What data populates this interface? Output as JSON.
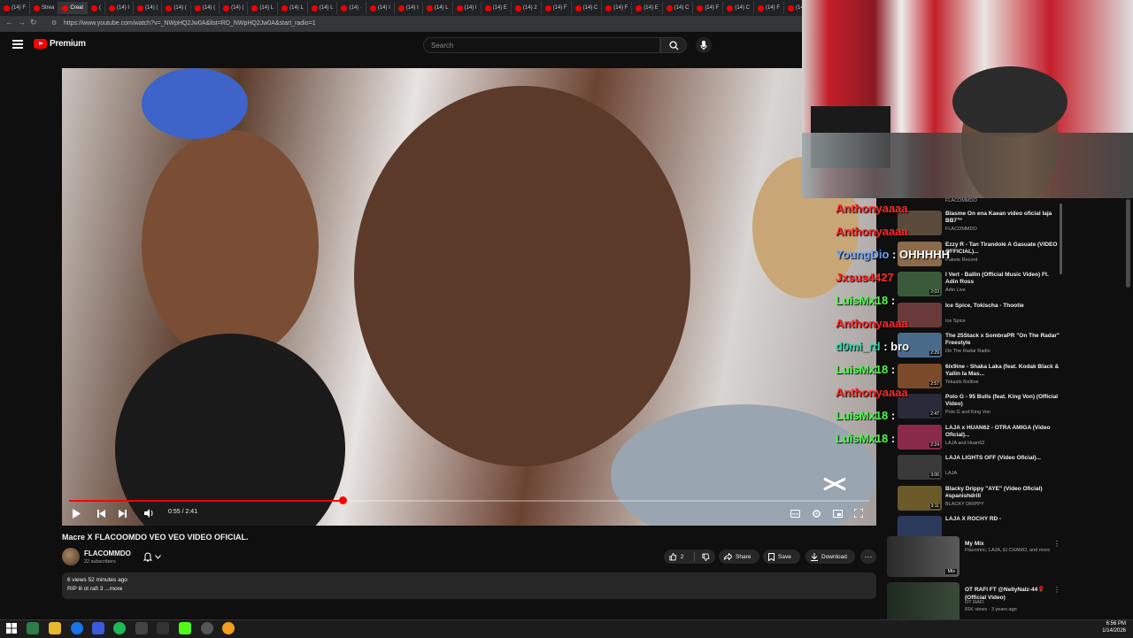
{
  "browser": {
    "tabs": [
      "(14) F",
      "Strea",
      "Creat",
      "(",
      "(14) I",
      "(14) (",
      "(14) (",
      "(14) (",
      "(14) (",
      "(14) L",
      "(14) L",
      "(14) L",
      "(14) ·",
      "(14) I",
      "(14) I",
      "(14) L",
      "(14) I",
      "(14) E",
      "(14) 2",
      "(14) F",
      "(14) C",
      "(14) F",
      "(14) E",
      "(14) C",
      "(14) F",
      "(14) C",
      "(14) F",
      "(14) F"
    ],
    "url": "https://www.youtube.com/watch?v=_NWpHQ2Jw0A&list=RD_NWpHQ2Jw0A&start_radio=1"
  },
  "header": {
    "logo_text": "Premium",
    "search_placeholder": "Search"
  },
  "player": {
    "time": "0:55 / 2:41",
    "progress": 0.342
  },
  "video": {
    "title": "Macre X FLACOOMDO VEO VEO VIDEO OFICIAL.",
    "channel": "FLACOMMDO",
    "subscribers": "22 subscribers",
    "likes": "2",
    "share_label": "Share",
    "save_label": "Save",
    "download_label": "Download",
    "views": "6 views  52 minutes ago",
    "description": "RIP lil ot rafi 3 ...more"
  },
  "chat": [
    {
      "user": "Anthonyaaaa",
      "msg": "",
      "color": "#ff2a2a"
    },
    {
      "user": "Anthonyaaaa",
      "msg": "",
      "color": "#ff2a2a"
    },
    {
      "user": "YoungDio",
      "msg": " : OHHHHH",
      "color": "#6fa8ff"
    },
    {
      "user": "Jxsus4427",
      "msg": "",
      "color": "#ff2a2a"
    },
    {
      "user": "LuisMx18",
      "msg": " :",
      "color": "#4cff4c"
    },
    {
      "user": "Anthonyaaaa",
      "msg": "",
      "color": "#ff2a2a"
    },
    {
      "user": "d0mi_rd",
      "msg": " : bro",
      "color": "#2ad4a8"
    },
    {
      "user": "LuisMx18",
      "msg": " :",
      "color": "#4cff4c"
    },
    {
      "user": "Anthonyaaaa",
      "msg": "",
      "color": "#ff2a2a"
    },
    {
      "user": "LuisMx18",
      "msg": " :",
      "color": "#4cff4c"
    },
    {
      "user": "LuisMx18",
      "msg": " :",
      "color": "#4cff4c"
    }
  ],
  "sidebar_top_channel": "FLACOMMDO",
  "playlist": [
    {
      "title": "Blasme On ena Kaean video oficial laja BB7™",
      "channel": "FLACOMMDO",
      "duration": ""
    },
    {
      "title": "Ezzy R - Tan Tirandole A Gasuate (VIDEO OFFICIAL)...",
      "channel": "Pakete Record",
      "duration": ""
    },
    {
      "title": "I Vert - Ballin (Official Music Video) Ft. Adin Ross",
      "channel": "Adin Live",
      "duration": "2:03"
    },
    {
      "title": "Ice Spice, Tokischa - Thootie",
      "channel": "Ice Spice",
      "duration": ""
    },
    {
      "title": "The 25Stack x SombraPR \"On The Radar\" Freestyle",
      "channel": "On The Radar Radio",
      "duration": "2:29"
    },
    {
      "title": "6ix9ine - Shaka Laka (feat. Kodak Black & Yailin la Mas...",
      "channel": "Tekashi 6ix9ine",
      "duration": "2:57"
    },
    {
      "title": "Polo G - 95 Bulls (feat. King Von) (Official Video)",
      "channel": "Polo G and King Von",
      "duration": "2:47"
    },
    {
      "title": "LAJA x HUAN62 - OTRA AMIGA (Video Oficial)...",
      "channel": "LAJA and Huan62",
      "duration": "2:24"
    },
    {
      "title": "LAJA LIGHTS OFF (Video Oficial)...",
      "channel": "LAJA",
      "duration": "3:06"
    },
    {
      "title": "Blacky Drippy \"AYE\" (Video Oficial) #spanishdrill",
      "channel": "BLACKY DRIPPY",
      "duration": "3:11"
    },
    {
      "title": "LAJA X ROCHY RD -",
      "channel": "",
      "duration": ""
    }
  ],
  "mix": [
    {
      "title": "My Mix",
      "channel": "Flacomnc, LAJA, El CHAMO, and more",
      "badge": "Mix"
    },
    {
      "title": "OT RAFI FT @NellyNalz-44🌹 (Official Video)",
      "channel": "OT RAFI",
      "meta": "81K views · 3 years ago"
    }
  ],
  "taskbar": {
    "time": "6:56 PM",
    "date": "1/14/2026"
  },
  "colors": {
    "accent": "#ff0000",
    "bg": "#0f0f0f",
    "chip": "#272727"
  }
}
